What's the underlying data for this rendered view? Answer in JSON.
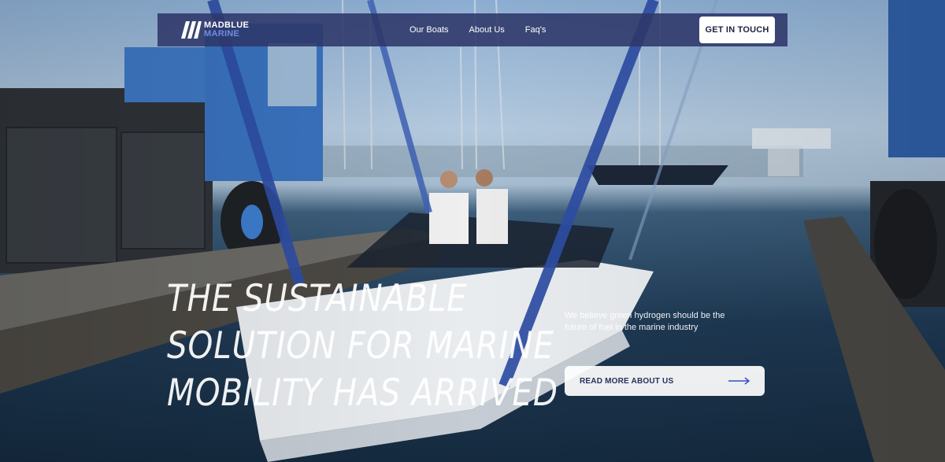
{
  "brand": {
    "line1": "MADBLUE",
    "line2": "MARINE",
    "accent": "#6e8ee0"
  },
  "nav": {
    "links": [
      "Our Boats",
      "About Us",
      "Faq's"
    ],
    "cta_label": "GET IN TOUCH",
    "background": "#2d3769"
  },
  "hero": {
    "headline": [
      "THE SUSTAINABLE",
      "SOLUTION FOR MARINE",
      "MOBILITY HAS ARRIVED"
    ],
    "tagline": "We believe green hydrogen should be the future of fuel in the marine industry",
    "read_more_label": "READ MORE ABOUT US",
    "arrow_icon": "arrow-right-icon"
  }
}
